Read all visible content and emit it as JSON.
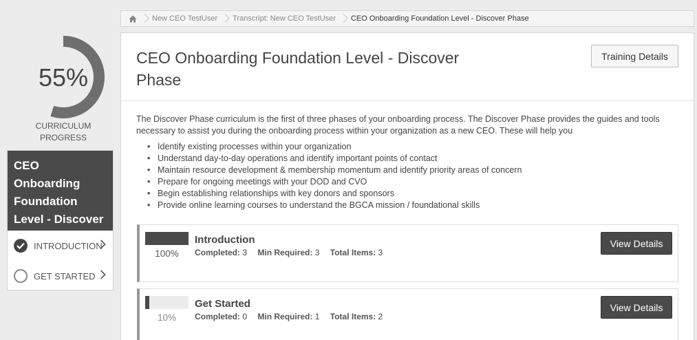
{
  "progress": {
    "percent_label": "55%",
    "value": 0.55,
    "caption_line1": "CURRICULUM",
    "caption_line2": "PROGRESS"
  },
  "sidebar": {
    "title": "CEO Onboarding Foundation Level - Discover Phase",
    "items": [
      {
        "label": "INTRODUCTION",
        "status": "complete",
        "icon": "check-circle-icon"
      },
      {
        "label": "GET STARTED",
        "status": "incomplete",
        "icon": "empty-circle-icon"
      }
    ]
  },
  "breadcrumb": {
    "home_icon": "home-icon",
    "items": [
      {
        "label": "New CEO TestUser"
      },
      {
        "label": "Transcript: New CEO TestUser"
      },
      {
        "label": "CEO Onboarding Foundation Level - Discover Phase"
      }
    ]
  },
  "main": {
    "title": "CEO Onboarding Foundation Level - Discover Phase",
    "training_details_label": "Training Details",
    "description": "The Discover Phase curriculum is the first of three phases of your onboarding process. The Discover Phase provides the guides and tools necessary to assist you during the onboarding process within your organization as a new CEO. These will help you",
    "bullets": [
      "Identify existing processes within your organization",
      "Understand day-to-day operations and identify important points of contact",
      "Maintain resource development & membership momentum and identify priority areas of concern",
      "Prepare for ongoing meetings with your DOD and CVO",
      "Begin establishing relationships with key donors and sponsors",
      "Provide online learning courses to understand the BGCA mission / foundational skills"
    ],
    "sections": [
      {
        "title": "Introduction",
        "percent_label": "100%",
        "progress": 1.0,
        "completed_label": "Completed:",
        "completed": "3",
        "min_required_label": "Min Required:",
        "min_required": "3",
        "total_items_label": "Total Items:",
        "total_items": "3",
        "button_label": "View Details"
      },
      {
        "title": "Get Started",
        "percent_label": "10%",
        "progress": 0.1,
        "completed_label": "Completed:",
        "completed": "0",
        "min_required_label": "Min Required:",
        "min_required": "1",
        "total_items_label": "Total Items:",
        "total_items": "2",
        "button_label": "View Details"
      }
    ]
  },
  "colors": {
    "dark": "#4a4a4a",
    "ring_track": "#ececec",
    "background": "#ececec"
  }
}
